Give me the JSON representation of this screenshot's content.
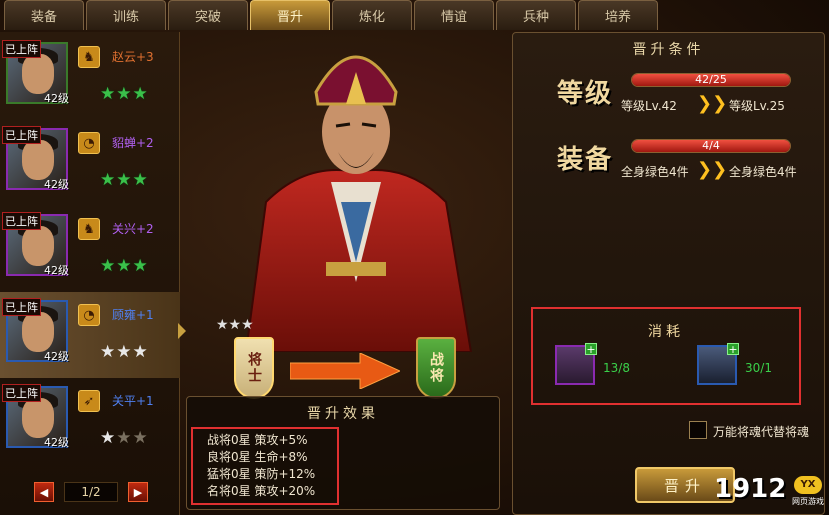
{
  "tabs": [
    {
      "label": "装备"
    },
    {
      "label": "训练"
    },
    {
      "label": "突破"
    },
    {
      "label": "晋升"
    },
    {
      "label": "炼化"
    },
    {
      "label": "情谊"
    },
    {
      "label": "兵种"
    },
    {
      "label": "培养"
    }
  ],
  "active_tab": "晋升",
  "heroes": [
    {
      "badge": "已上阵",
      "level": "42级",
      "name": "赵云+3",
      "name_color": "#e07030",
      "class_icon": "horse-icon",
      "stars": [
        "green",
        "green",
        "green"
      ]
    },
    {
      "badge": "已上阵",
      "level": "42级",
      "name": "貂蝉+2",
      "name_color": "#b060f0",
      "class_icon": "fan-icon",
      "stars": [
        "green",
        "green",
        "green"
      ]
    },
    {
      "badge": "已上阵",
      "level": "42级",
      "name": "关兴+2",
      "name_color": "#b060f0",
      "class_icon": "horse-icon",
      "stars": [
        "green",
        "green",
        "green"
      ]
    },
    {
      "badge": "已上阵",
      "level": "42级",
      "name": "顾雍+1",
      "name_color": "#5080f0",
      "class_icon": "fan-icon",
      "stars": [
        "white",
        "white",
        "white"
      ]
    },
    {
      "badge": "已上阵",
      "level": "42级",
      "name": "关平+1",
      "name_color": "#5080f0",
      "class_icon": "bow-icon",
      "stars": [
        "white",
        "dim",
        "dim"
      ]
    }
  ],
  "pager": {
    "text": "1/2",
    "prev": "◀",
    "next": "▶"
  },
  "promotion": {
    "from_rank": "将士",
    "to_rank": "战将",
    "effect_title": "晋升效果",
    "effects": [
      "战将0星 策攻+5%",
      "良将0星 生命+8%",
      "猛将0星 策防+12%",
      "名将0星 策攻+20%"
    ]
  },
  "conditions": {
    "title": "晋升条件",
    "level": {
      "label": "等级",
      "bar_text": "42/25",
      "fill": 1.0,
      "from": "等级Lv.42",
      "to": "等级Lv.25"
    },
    "equip": {
      "label": "装备",
      "bar_text": "4/4",
      "fill": 1.0,
      "from": "全身绿色4件",
      "to": "全身绿色4件"
    }
  },
  "cost": {
    "title": "消耗",
    "items": [
      {
        "icon": "bag-item-icon",
        "count": "13/8"
      },
      {
        "icon": "hero-soul-icon",
        "count": "30/1"
      }
    ]
  },
  "checkbox_label": "万能将魂代替将魂",
  "promote_button": "晋升",
  "logo": {
    "text": "1912",
    "badge": "YX",
    "sub": "网页游戏"
  }
}
